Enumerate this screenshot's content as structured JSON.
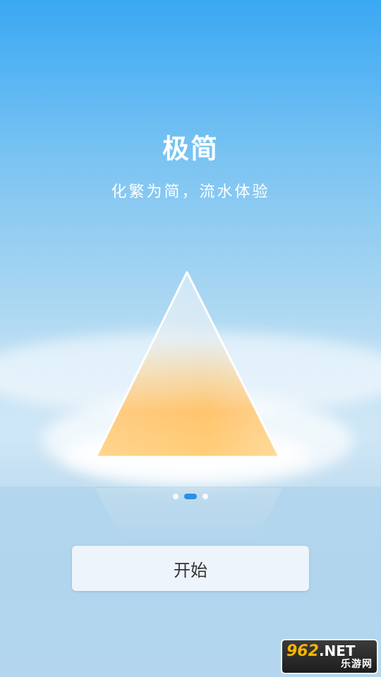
{
  "intro": {
    "title": "极简",
    "subtitle": "化繁为简，流水体验"
  },
  "pager": {
    "page_count": 3,
    "active_index": 1
  },
  "start_button": {
    "label": "开始"
  },
  "watermark": {
    "brand_number": "962",
    "brand_suffix": ".NET",
    "brand_name": "乐游网"
  },
  "colors": {
    "sky_top": "#3aa8f3",
    "sky_mid": "#b2daf3",
    "active_dot": "#2d8ee6",
    "button_bg": "#eef4fc",
    "pyramid_top": "#eef6fb",
    "pyramid_bottom": "#ffc66a"
  }
}
